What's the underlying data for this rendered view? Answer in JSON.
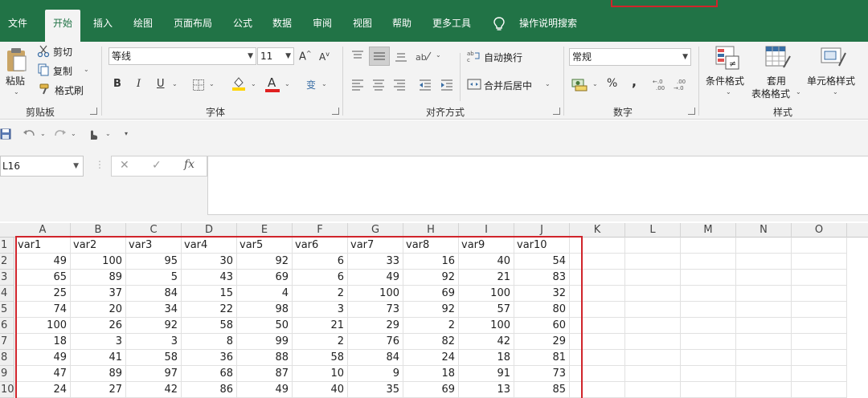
{
  "tabs": [
    "文件",
    "开始",
    "插入",
    "绘图",
    "页面布局",
    "公式",
    "数据",
    "审阅",
    "视图",
    "帮助",
    "更多工具",
    "操作说明搜索"
  ],
  "clipboard": {
    "paste": "粘贴",
    "cut": "剪切",
    "copy": "复制",
    "format_painter": "格式刷",
    "label": "剪贴板"
  },
  "font": {
    "name": "等线",
    "size": "11",
    "grow": "A",
    "shrink": "A",
    "bold": "B",
    "italic": "I",
    "underline": "U",
    "color_letter": "A",
    "phonetic": "变",
    "label": "字体"
  },
  "alignment": {
    "wrap": "自动换行",
    "merge": "合并后居中",
    "label": "对齐方式"
  },
  "number": {
    "format": "常规",
    "percent": "%",
    "comma": ",",
    "inc_decimal": ".0→.00",
    "dec_decimal": ".00→.0",
    "label": "数字"
  },
  "styles": {
    "conditional": "条件格式",
    "table_line1": "套用",
    "table_line2": "表格格式",
    "cell_styles": "单元格样式",
    "label": "样式"
  },
  "formula_bar": {
    "name_box": "L16",
    "fx": "fx",
    "cancel": "✕",
    "enter": "✓"
  },
  "colors": {
    "brand": "#217346",
    "highlight": "#d0242b",
    "fill_yellow": "#ffd400",
    "font_red": "#e02020"
  },
  "columns": [
    "A",
    "B",
    "C",
    "D",
    "E",
    "F",
    "G",
    "H",
    "I",
    "J",
    "K",
    "L",
    "M",
    "N",
    "O"
  ],
  "rows": [
    "1",
    "2",
    "3",
    "4",
    "5",
    "6",
    "7",
    "8",
    "9",
    "10"
  ],
  "headers": [
    "var1",
    "var2",
    "var3",
    "var4",
    "var5",
    "var6",
    "var7",
    "var8",
    "var9",
    "var10"
  ],
  "data": [
    [
      "49",
      "100",
      "95",
      "30",
      "92",
      "6",
      "33",
      "16",
      "40",
      "54"
    ],
    [
      "65",
      "89",
      "5",
      "43",
      "69",
      "6",
      "49",
      "92",
      "21",
      "83"
    ],
    [
      "25",
      "37",
      "84",
      "15",
      "4",
      "2",
      "100",
      "69",
      "100",
      "32"
    ],
    [
      "74",
      "20",
      "34",
      "22",
      "98",
      "3",
      "73",
      "92",
      "57",
      "80"
    ],
    [
      "100",
      "26",
      "92",
      "58",
      "50",
      "21",
      "29",
      "2",
      "100",
      "60"
    ],
    [
      "18",
      "3",
      "3",
      "8",
      "99",
      "2",
      "76",
      "82",
      "42",
      "29"
    ],
    [
      "49",
      "41",
      "58",
      "36",
      "88",
      "58",
      "84",
      "24",
      "18",
      "81"
    ],
    [
      "47",
      "89",
      "97",
      "68",
      "87",
      "10",
      "9",
      "18",
      "91",
      "73"
    ],
    [
      "24",
      "27",
      "42",
      "86",
      "49",
      "40",
      "35",
      "69",
      "13",
      "85"
    ]
  ]
}
